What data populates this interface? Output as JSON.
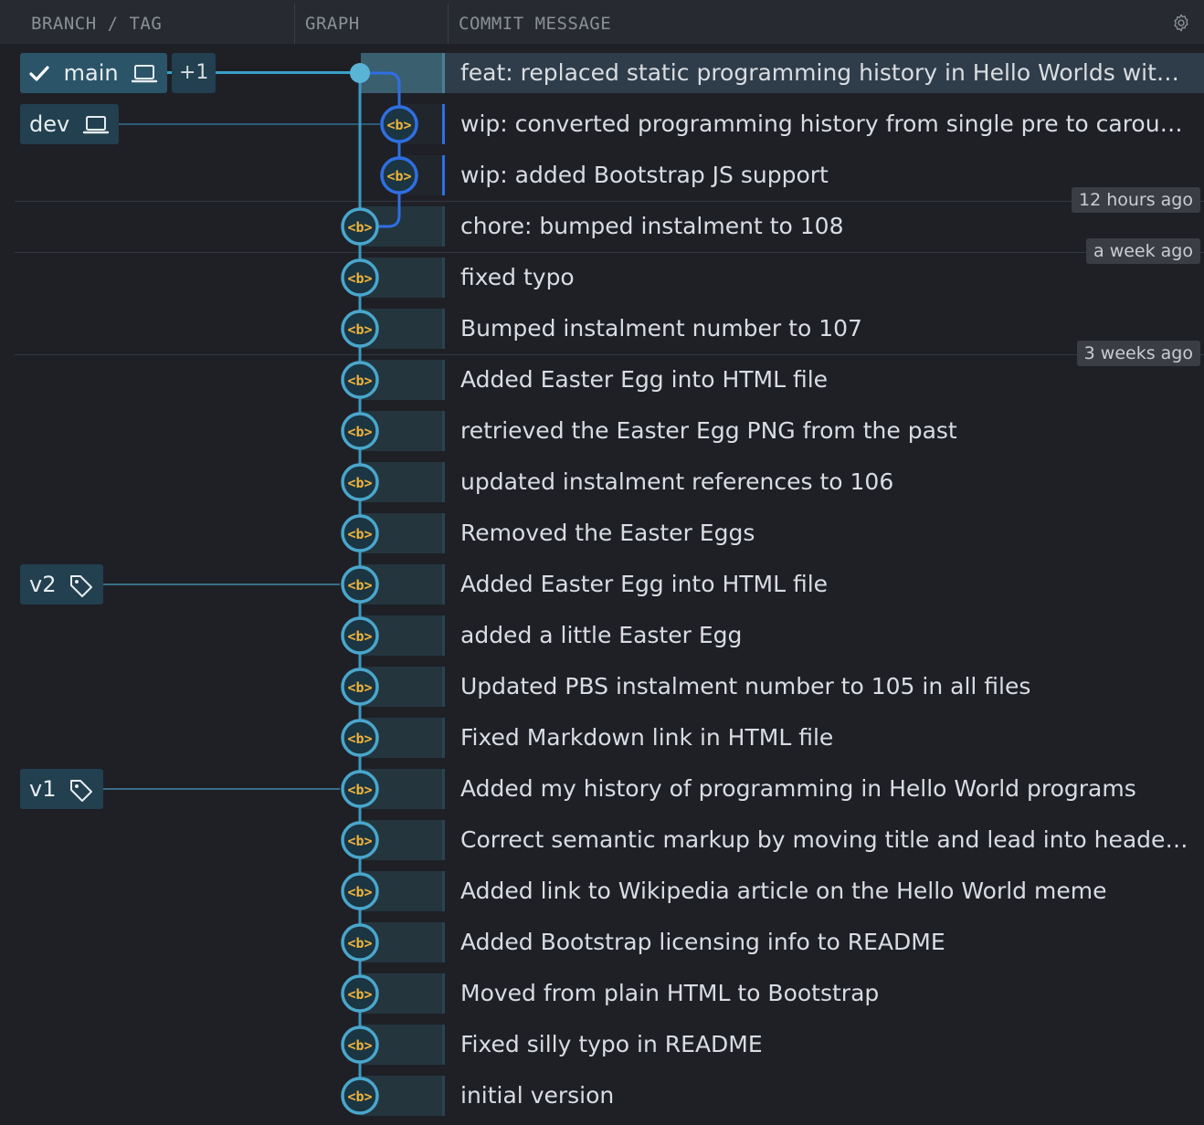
{
  "header": {
    "branch_tag_label": "BRANCH / TAG",
    "graph_label": "GRAPH",
    "commit_message_label": "COMMIT MESSAGE",
    "settings_icon": "gear-icon"
  },
  "refs": {
    "main": {
      "label": "main",
      "check_icon": "check-icon",
      "type_icon": "laptop-icon",
      "extra": "+1"
    },
    "dev": {
      "label": "dev",
      "type_icon": "laptop-icon"
    },
    "v2": {
      "label": "v2",
      "type_icon": "tag-icon"
    },
    "v1": {
      "label": "v1",
      "type_icon": "tag-icon"
    }
  },
  "node_avatar_text": "<b>",
  "dates": [
    "12 hours ago",
    "a week ago",
    "3 weeks ago"
  ],
  "commits": [
    {
      "message": "feat: replaced static programming history in Hello Worlds with carousel"
    },
    {
      "message": "wip: converted programming history from single pre to carousel"
    },
    {
      "message": "wip: added Bootstrap JS support"
    },
    {
      "message": "chore: bumped instalment to 108"
    },
    {
      "message": "fixed typo"
    },
    {
      "message": "Bumped instalment number to 107"
    },
    {
      "message": "Added Easter Egg into HTML file"
    },
    {
      "message": "retrieved the Easter Egg PNG from the past"
    },
    {
      "message": "updated instalment references to 106"
    },
    {
      "message": "Removed the Easter Eggs"
    },
    {
      "message": "Added Easter Egg into HTML file"
    },
    {
      "message": "added a little Easter Egg"
    },
    {
      "message": "Updated PBS instalment number to 105 in all files"
    },
    {
      "message": "Fixed Markdown link in HTML file"
    },
    {
      "message": "Added my history of programming in Hello World programs"
    },
    {
      "message": "Correct semantic markup by moving title and lead into header and ad..."
    },
    {
      "message": "Added link to Wikipedia article on the Hello World meme"
    },
    {
      "message": "Added Bootstrap licensing info to README"
    },
    {
      "message": "Moved from plain HTML to Bootstrap"
    },
    {
      "message": "Fixed silly typo in README"
    },
    {
      "message": "initial version"
    }
  ]
}
